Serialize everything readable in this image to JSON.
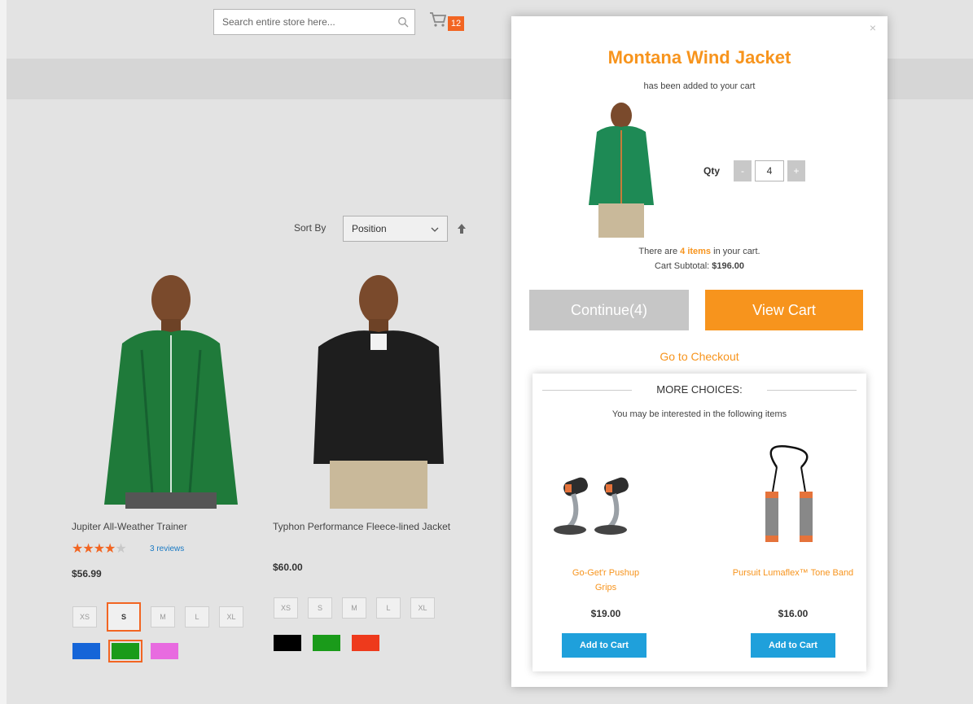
{
  "header": {
    "search_placeholder": "Search entire store here...",
    "cart_count": "12"
  },
  "toolbar": {
    "sort_label": "Sort By",
    "sort_value": "Position"
  },
  "products": [
    {
      "name": "Jupiter All-Weather Trainer",
      "rating_stars": 4,
      "reviews": "3 reviews",
      "price": "$56.99",
      "sizes": [
        "XS",
        "S",
        "M",
        "L",
        "XL"
      ],
      "selected_size": "S",
      "colors": [
        "#1565d8",
        "#1a9b1a",
        "#e86be0"
      ],
      "selected_color": "#1a9b1a"
    },
    {
      "name": "Typhon Performance Fleece-lined Jacket",
      "price": "$60.00",
      "sizes": [
        "XS",
        "S",
        "M",
        "L",
        "XL"
      ],
      "colors": [
        "#000000",
        "#1a9b1a",
        "#ee3a1c"
      ]
    }
  ],
  "modal": {
    "close_icon": "×",
    "title": "Montana Wind Jacket",
    "subtitle": "has been added to your cart",
    "qty_label": "Qty",
    "qty_minus": "-",
    "qty_value": "4",
    "qty_plus": "+",
    "cart_items_prefix": "There are ",
    "cart_items_count": "4 items",
    "cart_items_suffix": " in your cart.",
    "subtotal_label": "Cart Subtotal: ",
    "subtotal_value": "$196.00",
    "continue_label": "Continue(4)",
    "view_cart_label": "View Cart",
    "checkout_label": "Go to Checkout",
    "more_choices_title": "MORE CHOICES:",
    "more_choices_sub": "You may be interested in the following items",
    "recommendations": [
      {
        "name": "Go-Get'r Pushup Grips",
        "price": "$19.00",
        "button": "Add to Cart"
      },
      {
        "name": "Pursuit Lumaflex™ Tone Band",
        "price": "$16.00",
        "button": "Add to Cart"
      }
    ]
  },
  "colors": {
    "accent_orange": "#f7941d",
    "badge_orange": "#f26522",
    "button_blue": "#1fa0db",
    "continue_gray": "#c6c6c6"
  }
}
